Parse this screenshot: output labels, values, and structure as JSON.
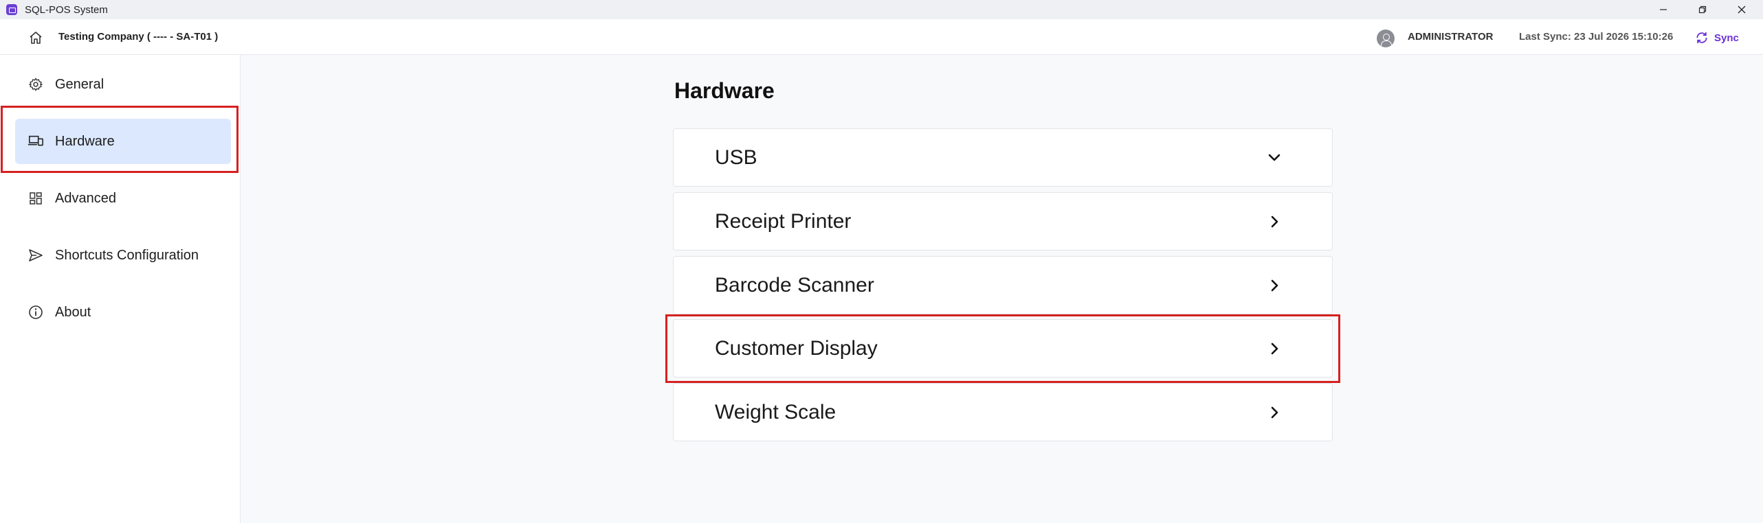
{
  "window": {
    "title": "SQL-POS System"
  },
  "header": {
    "company": "Testing Company ( ---- - SA-T01 )",
    "user": "ADMINISTRATOR",
    "last_sync": "Last Sync: 23 Jul 2026 15:10:26",
    "sync_label": "Sync",
    "accent_color": "#6a2fd6"
  },
  "sidebar": {
    "items": [
      {
        "label": "General",
        "icon": "gear-icon"
      },
      {
        "label": "Hardware",
        "icon": "devices-icon",
        "active": true
      },
      {
        "label": "Advanced",
        "icon": "dashboard-icon"
      },
      {
        "label": "Shortcuts Configuration",
        "icon": "send-icon"
      },
      {
        "label": "About",
        "icon": "info-icon"
      }
    ],
    "active_bg": "#dbe8fd"
  },
  "main": {
    "title": "Hardware",
    "sections": [
      {
        "label": "USB",
        "icon": "chevron-down-icon"
      },
      {
        "label": "Receipt Printer",
        "icon": "chevron-right-icon"
      },
      {
        "label": "Barcode Scanner",
        "icon": "chevron-right-icon"
      },
      {
        "label": "Customer Display",
        "icon": "chevron-right-icon"
      },
      {
        "label": "Weight Scale",
        "icon": "chevron-right-icon"
      }
    ]
  },
  "annotations": {
    "highlight_color": "#d62020"
  }
}
